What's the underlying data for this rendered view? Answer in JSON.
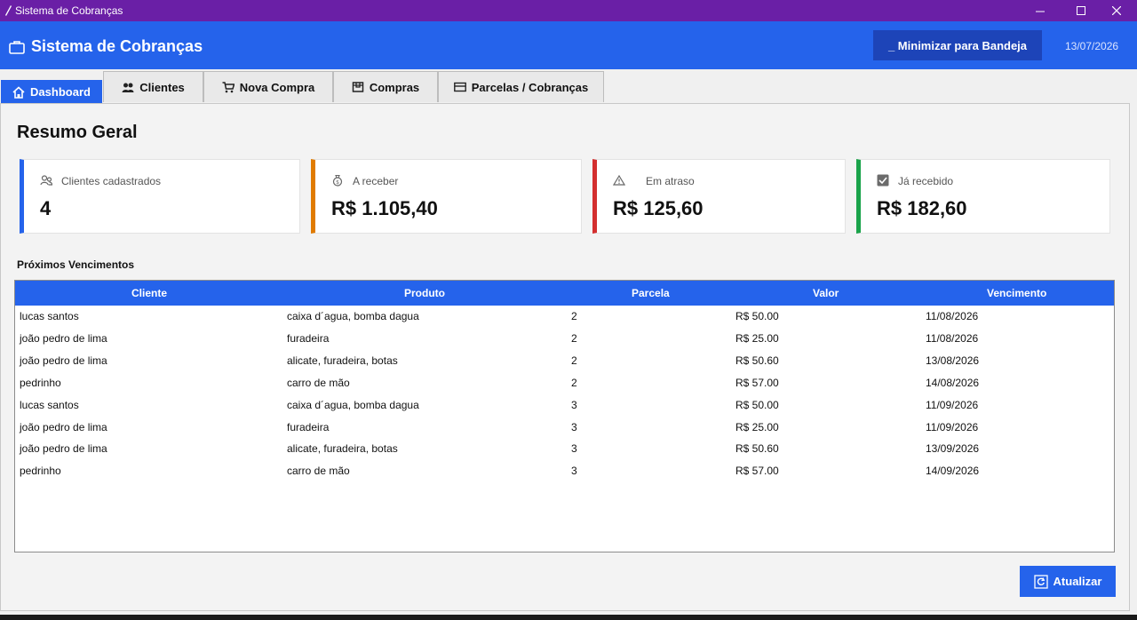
{
  "window": {
    "title": "Sistema de Cobranças"
  },
  "header": {
    "title": "Sistema de Cobranças",
    "tray_button": "_ Minimizar para Bandeja",
    "date": "13/07/2026"
  },
  "tabs": [
    {
      "label": "Dashboard",
      "icon": "home-icon",
      "active": true
    },
    {
      "label": "Clientes",
      "icon": "users-icon",
      "active": false
    },
    {
      "label": "Nova Compra",
      "icon": "cart-icon",
      "active": false
    },
    {
      "label": "Compras",
      "icon": "box-icon",
      "active": false
    },
    {
      "label": "Parcelas / Cobranças",
      "icon": "card-icon",
      "active": false
    }
  ],
  "summary": {
    "title": "Resumo Geral",
    "cards": [
      {
        "label": "Clientes cadastrados",
        "value": "4",
        "icon": "users-icon",
        "color": "#2563eb"
      },
      {
        "label": "A receber",
        "value": "R$ 1.105,40",
        "icon": "money-bag-icon",
        "color": "#e07b00"
      },
      {
        "label": "Em atraso",
        "value": "R$ 125,60",
        "icon": "warning-icon",
        "color": "#d32f2f"
      },
      {
        "label": "Já recebido",
        "value": "R$ 182,60",
        "icon": "check-box-icon",
        "color": "#1aa34a"
      }
    ]
  },
  "upcoming": {
    "title": "Próximos Vencimentos",
    "columns": [
      "Cliente",
      "Produto",
      "Parcela",
      "Valor",
      "Vencimento"
    ],
    "rows": [
      [
        "lucas santos",
        "caixa d´agua, bomba dagua",
        "2",
        "R$ 50.00",
        "11/08/2026"
      ],
      [
        "joão pedro de lima",
        "furadeira",
        "2",
        "R$ 25.00",
        "11/08/2026"
      ],
      [
        "joão pedro de lima",
        "alicate, furadeira, botas",
        "2",
        "R$ 50.60",
        "13/08/2026"
      ],
      [
        "pedrinho",
        "carro de mão",
        "2",
        "R$ 57.00",
        "14/08/2026"
      ],
      [
        "lucas santos",
        "caixa d´agua, bomba dagua",
        "3",
        "R$ 50.00",
        "11/09/2026"
      ],
      [
        "joão pedro de lima",
        "furadeira",
        "3",
        "R$ 25.00",
        "11/09/2026"
      ],
      [
        "joão pedro de lima",
        "alicate, furadeira, botas",
        "3",
        "R$ 50.60",
        "13/09/2026"
      ],
      [
        "pedrinho",
        "carro de mão",
        "3",
        "R$ 57.00",
        "14/09/2026"
      ]
    ]
  },
  "actions": {
    "refresh": "Atualizar"
  }
}
